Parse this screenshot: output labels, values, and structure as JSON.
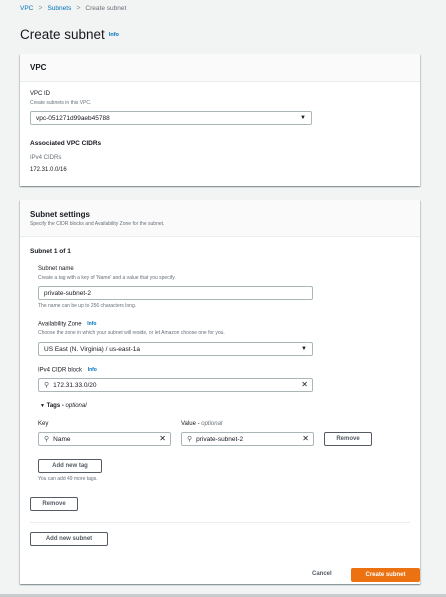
{
  "breadcrumb": {
    "items": [
      "VPC",
      "Subnets",
      "Create subnet"
    ],
    "separator": ">"
  },
  "page": {
    "title": "Create subnet",
    "info": "Info"
  },
  "vpc_panel": {
    "title": "VPC",
    "vpc_id_label": "VPC ID",
    "vpc_id_desc": "Create subnets in this VPC.",
    "vpc_id_value": "vpc-051271d99aeb45788",
    "cidrs_title": "Associated VPC CIDRs",
    "ipv4_cidrs_label": "IPv4 CIDRs",
    "ipv4_cidr_value": "172.31.0.0/16"
  },
  "subnet_settings": {
    "title": "Subnet settings",
    "desc": "Specify the CIDR blocks and Availability Zone for the subnet.",
    "subnet_heading": "Subnet 1 of 1",
    "name_label": "Subnet name",
    "name_desc": "Create a tag with a key of 'Name' and a value that you specify.",
    "name_value": "private-subnet-2",
    "name_hint": "The name can be up to 256 characters long.",
    "az_label": "Availability Zone",
    "az_info": "Info",
    "az_desc": "Choose the zone in which your subnet will reside, or let Amazon choose one for you.",
    "az_value": "US East (N. Virginia) / us-east-1a",
    "cidr_label": "IPv4 CIDR block",
    "cidr_info": "Info",
    "cidr_value": "172.31.33.0/20",
    "tags_toggle": "Tags",
    "tags_optional": "optional",
    "key_label": "Key",
    "value_label": "Value",
    "value_optional": "optional",
    "tag_key": "Name",
    "tag_value": "private-subnet-2",
    "remove_tag_button": "Remove",
    "add_tag_button": "Add new tag",
    "tags_hint": "You can add 49 more tags.",
    "remove_subnet_button": "Remove",
    "add_subnet_button": "Add new subnet"
  },
  "footer": {
    "cancel_button": "Cancel",
    "create_button": "Create subnet"
  },
  "icons": {
    "caret": "caret-down-icon",
    "search": "search-icon",
    "clear": "clear-icon",
    "expand": "expand-triangle-icon"
  },
  "colors": {
    "link": "#0073bb",
    "primary": "#ec7211",
    "background": "#f2f3f3"
  }
}
